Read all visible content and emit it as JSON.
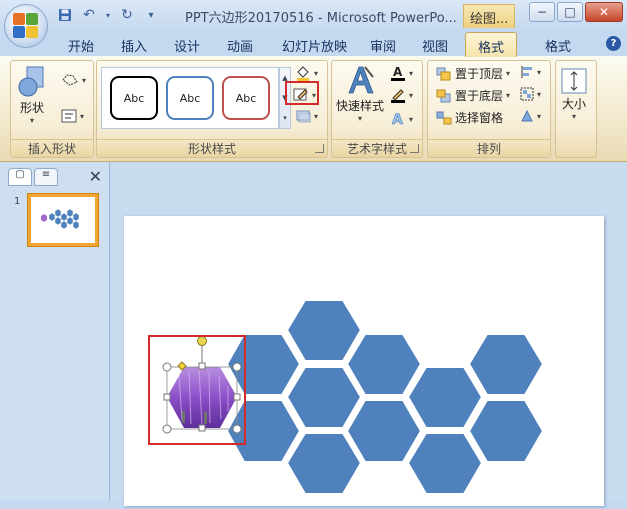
{
  "app": {
    "window_title": "PPT六边形20170516 - Microsoft PowerPo...",
    "context_tab_title": "绘图..."
  },
  "window_controls": {
    "minimize": "−",
    "maximize": "□",
    "close": "✕"
  },
  "quick_access": {
    "save_icon": "save-icon",
    "undo_icon": "undo-icon",
    "redo_icon": "redo-icon",
    "customize_icon": "customize-icon"
  },
  "tabs": [
    {
      "label": "开始",
      "active": false
    },
    {
      "label": "插入",
      "active": false
    },
    {
      "label": "设计",
      "active": false
    },
    {
      "label": "动画",
      "active": false
    },
    {
      "label": "幻灯片放映",
      "active": false
    },
    {
      "label": "审阅",
      "active": false
    },
    {
      "label": "视图",
      "active": false
    },
    {
      "label": "格式",
      "active": true
    },
    {
      "label": "格式",
      "active": false
    }
  ],
  "ribbon": {
    "insert_shapes": {
      "label": "插入形状",
      "shapes_button": "形状"
    },
    "shape_styles": {
      "label": "形状样式",
      "gallery": [
        {
          "text": "Abc",
          "border": "#000000"
        },
        {
          "text": "Abc",
          "border": "#4f81bd"
        },
        {
          "text": "Abc",
          "border": "#c0504d"
        }
      ]
    },
    "wordart_styles": {
      "label": "艺术字样式",
      "quick_styles": "快速样式"
    },
    "arrange": {
      "label": "排列",
      "bring_front": "置于顶层",
      "send_back": "置于底层",
      "selection_pane": "选择窗格"
    },
    "size": {
      "label": "大小"
    }
  },
  "left_pane": {
    "slide_number": "1",
    "close": "✕"
  },
  "slide": {
    "hex_fill": "#4f81bd",
    "selected_picture": "lavender-photo"
  },
  "colors": {
    "accent_red": "#d12b2b",
    "hex_blue": "#4f81bd",
    "context_tab": "#f4e3a8"
  }
}
